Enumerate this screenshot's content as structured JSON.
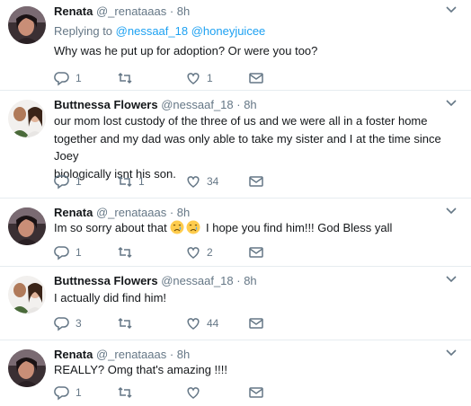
{
  "tweets": [
    {
      "author_name": "Renata",
      "handle_time": "@_renataaas · 8h",
      "replying_prefix": "Replying to",
      "replying_handles": "@nessaaf_18 @honeyjuicee",
      "text": "Why was he put up for adoption? Or were you too?",
      "reply_count": "1",
      "retweet_count": "",
      "like_count": "1",
      "avatar": "renata"
    },
    {
      "author_name": "Buttnessa Flowers",
      "handle_time": "@nessaaf_18 · 8h",
      "text_lines": [
        "our mom lost custody of the three of us and we were all in a foster home",
        "together and my dad was only able to take my sister and I at the time since Joey",
        "biologically isnt his son."
      ],
      "reply_count": "1",
      "retweet_count": "1",
      "like_count": "34",
      "avatar": "buttnessa"
    },
    {
      "author_name": "Renata",
      "handle_time": "@_renataaas · 8h",
      "text_before": "Im so sorry about that",
      "text_after": "I hope you find him!!! God Bless yall",
      "emoji": [
        "crying-face",
        "crying-face"
      ],
      "reply_count": "1",
      "retweet_count": "",
      "like_count": "2",
      "avatar": "renata"
    },
    {
      "author_name": "Buttnessa Flowers",
      "handle_time": "@nessaaf_18 · 8h",
      "text": "I actually did find him!",
      "reply_count": "3",
      "retweet_count": "",
      "like_count": "44",
      "avatar": "buttnessa"
    },
    {
      "author_name": "Renata",
      "handle_time": "@_renataaas · 8h",
      "text": "REALLY? Omg that's amazing !!!!",
      "reply_count": "1",
      "retweet_count": "",
      "like_count": "",
      "avatar": "renata"
    }
  ],
  "icons": {
    "reply": "reply-icon",
    "retweet": "retweet-icon",
    "like": "heart-icon",
    "dm": "envelope-icon",
    "more": "chevron-down-icon"
  },
  "colors": {
    "link": "#1da1f2",
    "secondary": "#657786",
    "divider": "#e6ecf0"
  }
}
